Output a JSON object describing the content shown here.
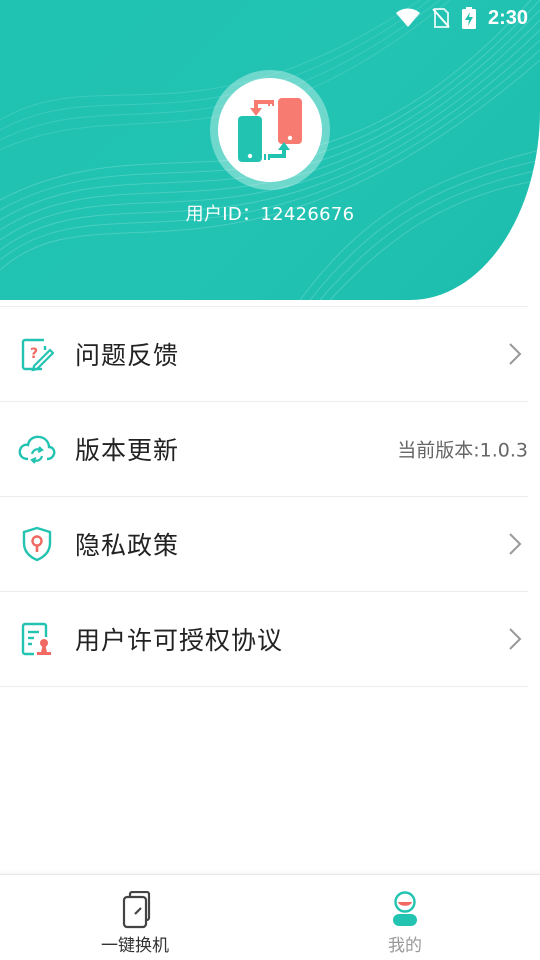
{
  "status_bar": {
    "time": "2:30"
  },
  "header": {
    "user_id_label": "用户ID：",
    "user_id": "12426676",
    "accent": "#22c3b3"
  },
  "menu": {
    "items": [
      {
        "label": "问题反馈",
        "icon": "feedback-icon"
      },
      {
        "label": "版本更新",
        "icon": "cloud-sync-icon",
        "value": "当前版本:1.0.3"
      },
      {
        "label": "隐私政策",
        "icon": "shield-icon"
      },
      {
        "label": "用户许可授权协议",
        "icon": "license-document-icon"
      }
    ]
  },
  "bottom_nav": {
    "items": [
      {
        "label": "一键换机",
        "icon": "phone-transfer-icon"
      },
      {
        "label": "我的",
        "icon": "profile-icon",
        "active": true
      }
    ]
  }
}
